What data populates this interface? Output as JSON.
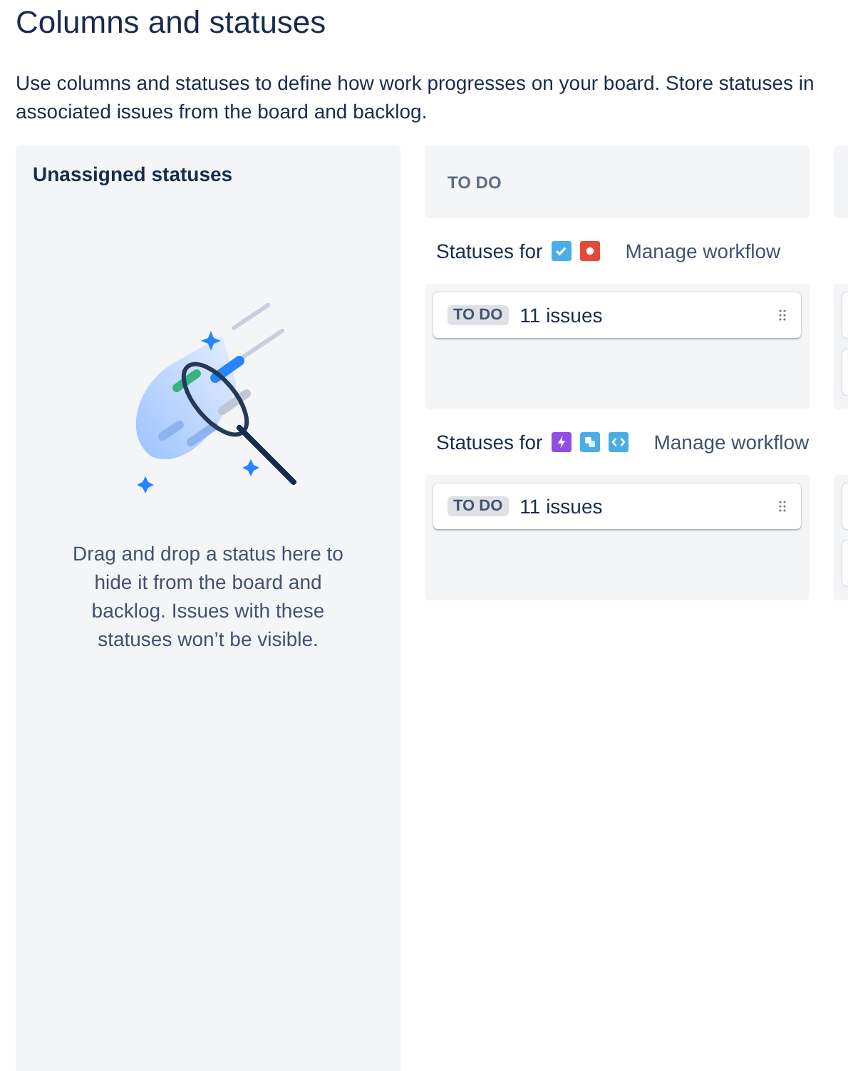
{
  "title": "Columns and statuses",
  "description_lines": [
    "Use columns and statuses to define how work progresses on your board. Store statuses in",
    "associated issues from the board and backlog."
  ],
  "unassigned": {
    "title": "Unassigned statuses",
    "hint": "Drag and drop a status here to hide it from the board and backlog. Issues with these statuses won’t be visible."
  },
  "column": {
    "title": "TO DO",
    "groups": [
      {
        "label": "Statuses for",
        "issue_types": [
          {
            "kind": "task",
            "color": "#4bade8"
          },
          {
            "kind": "bug",
            "color": "#e5493a"
          }
        ],
        "link": "Manage workflow",
        "statuses": [
          {
            "lozenge": "TO DO",
            "count": "11 issues"
          }
        ]
      },
      {
        "label": "Statuses for",
        "issue_types": [
          {
            "kind": "epic",
            "color": "#904ee2"
          },
          {
            "kind": "subtask",
            "color": "#4bade8"
          },
          {
            "kind": "code",
            "color": "#4bade8"
          }
        ],
        "link": "Manage workflow",
        "statuses": [
          {
            "lozenge": "TO DO",
            "count": "11 issues"
          }
        ]
      }
    ]
  }
}
